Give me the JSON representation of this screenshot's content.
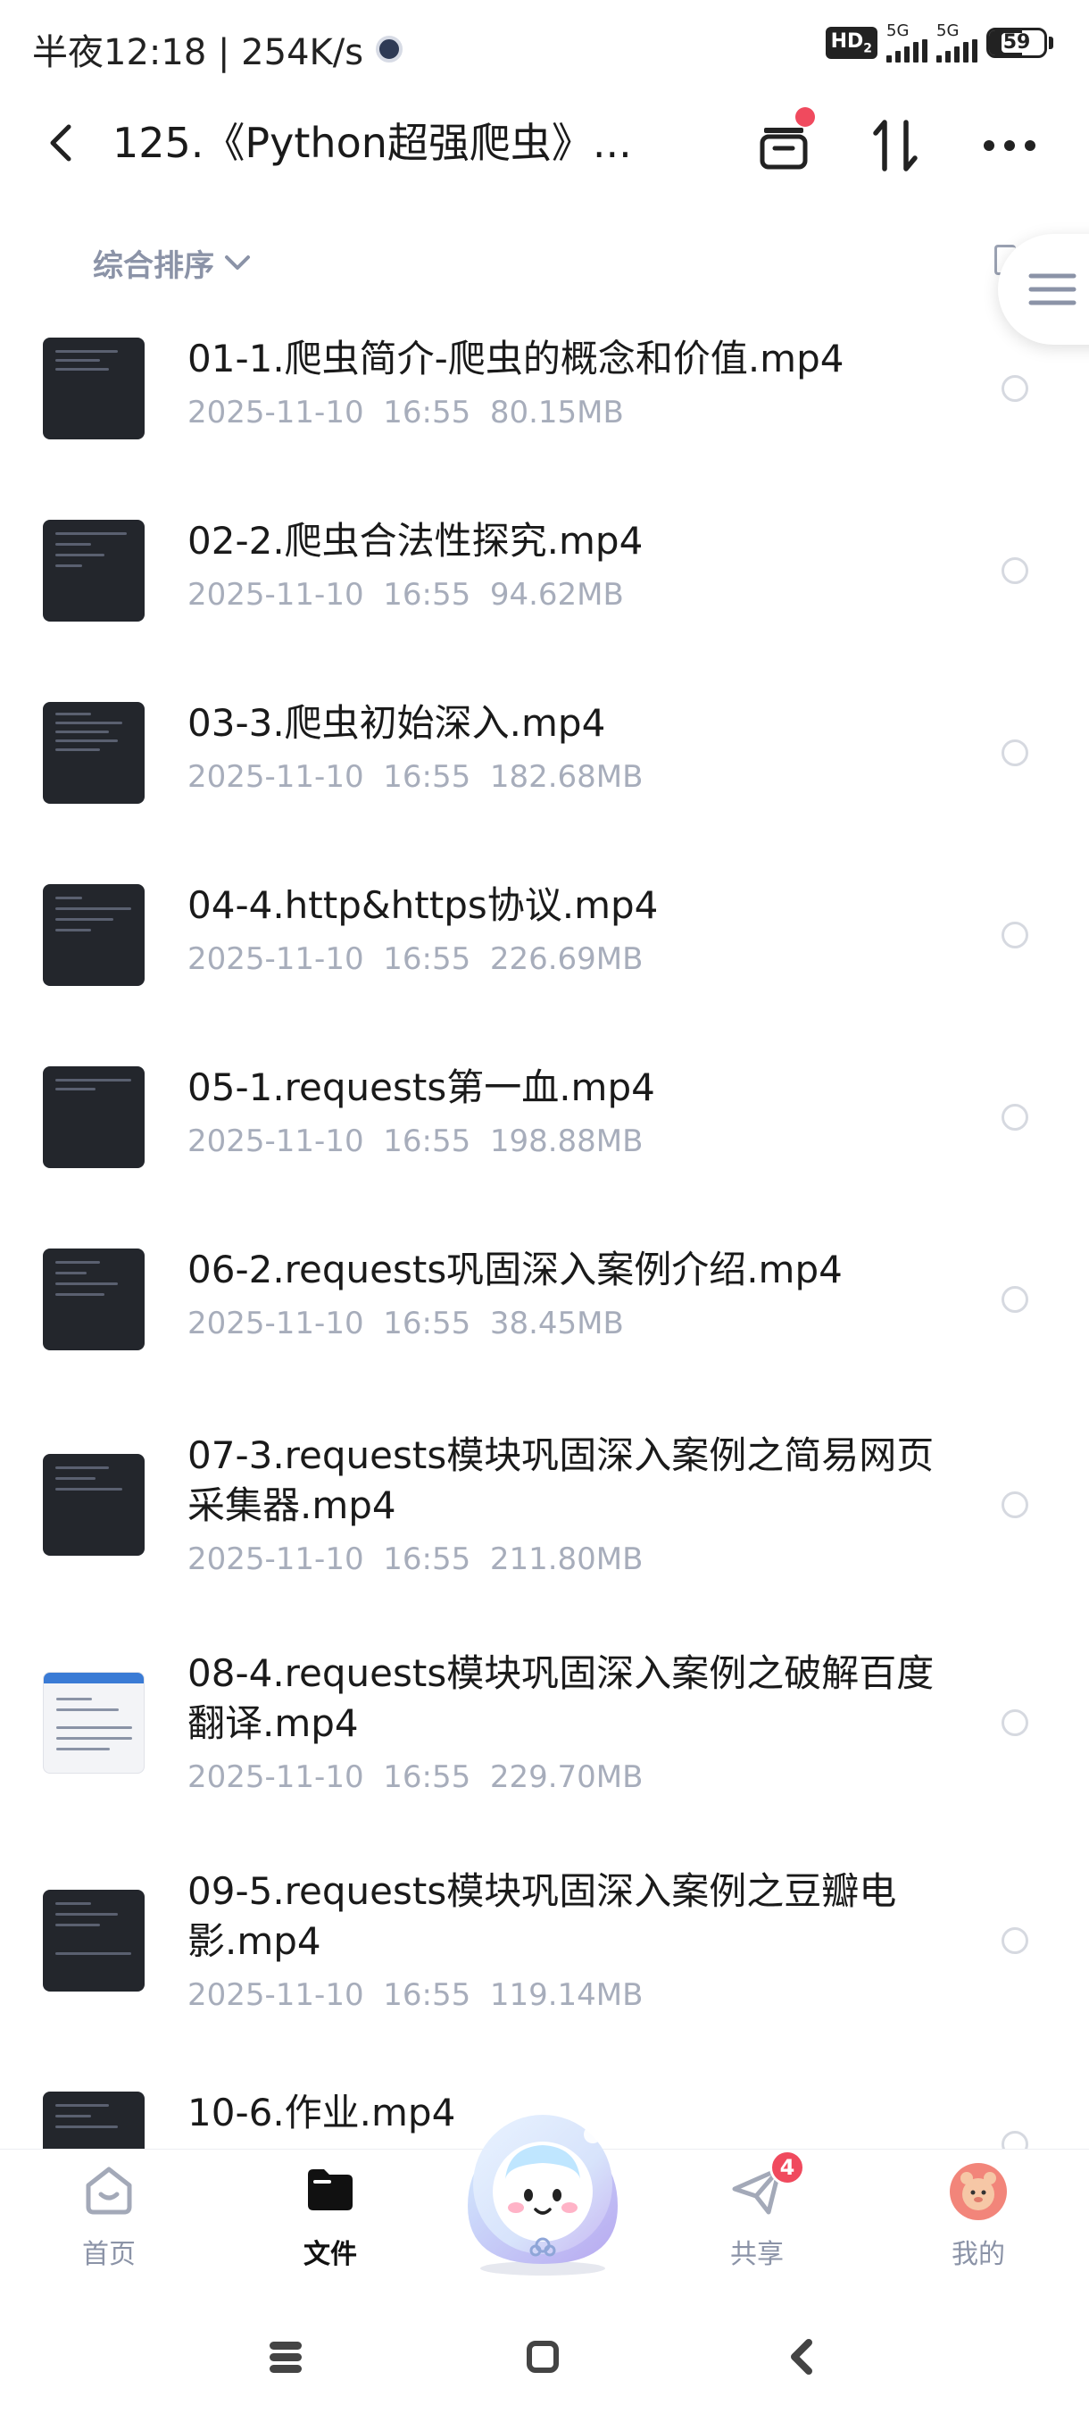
{
  "status_bar": {
    "time_speed": "半夜12:18 | 254K/s",
    "hd_label": "HD",
    "hd_sub": "2",
    "sim1_label": "5G",
    "sim2_label": "5G",
    "battery_percent": "59",
    "battery_level": 0.59
  },
  "header": {
    "title": "125.《Python超强爬虫》...",
    "back_icon": "chevron-left-icon",
    "icons": [
      "archive-box-icon",
      "transfer-arrows-icon",
      "more-dots-icon"
    ],
    "notification_dot_color": "#f04a5e"
  },
  "sort": {
    "label": "综合排序"
  },
  "files": [
    {
      "name": "01-1.爬虫简介-爬虫的概念和价值.mp4",
      "date": "2025-11-10",
      "time": "16:55",
      "size": "80.15MB"
    },
    {
      "name": "02-2.爬虫合法性探究.mp4",
      "date": "2025-11-10",
      "time": "16:55",
      "size": "94.62MB"
    },
    {
      "name": "03-3.爬虫初始深入.mp4",
      "date": "2025-11-10",
      "time": "16:55",
      "size": "182.68MB"
    },
    {
      "name": "04-4.http&https协议.mp4",
      "date": "2025-11-10",
      "time": "16:55",
      "size": "226.69MB"
    },
    {
      "name": "05-1.requests第一血.mp4",
      "date": "2025-11-10",
      "time": "16:55",
      "size": "198.88MB"
    },
    {
      "name": "06-2.requests巩固深入案例介绍.mp4",
      "date": "2025-11-10",
      "time": "16:55",
      "size": "38.45MB"
    },
    {
      "name": "07-3.requests模块巩固深入案例之简易网页采集器.mp4",
      "date": "2025-11-10",
      "time": "16:55",
      "size": "211.80MB"
    },
    {
      "name": "08-4.requests模块巩固深入案例之破解百度翻译.mp4",
      "date": "2025-11-10",
      "time": "16:55",
      "size": "229.70MB"
    },
    {
      "name": "09-5.requests模块巩固深入案例之豆瓣电影.mp4",
      "date": "2025-11-10",
      "time": "16:55",
      "size": "119.14MB"
    },
    {
      "name": "10-6.作业.mp4",
      "date": "",
      "time": "",
      "size": ""
    }
  ],
  "bottom_nav": {
    "items": [
      {
        "label": "首页",
        "icon": "home-icon",
        "active": false
      },
      {
        "label": "文件",
        "icon": "folder-icon",
        "active": true
      },
      {
        "label": "共享",
        "icon": "paper-plane-icon",
        "active": false,
        "badge": "4"
      },
      {
        "label": "我的",
        "icon": "profile-avatar-icon",
        "active": false
      }
    ],
    "center_icon": "ai-mascot-icon"
  },
  "colors": {
    "accent_red": "#f04a5e",
    "muted_text": "#a7adbb",
    "sort_text": "#8b93a7"
  }
}
